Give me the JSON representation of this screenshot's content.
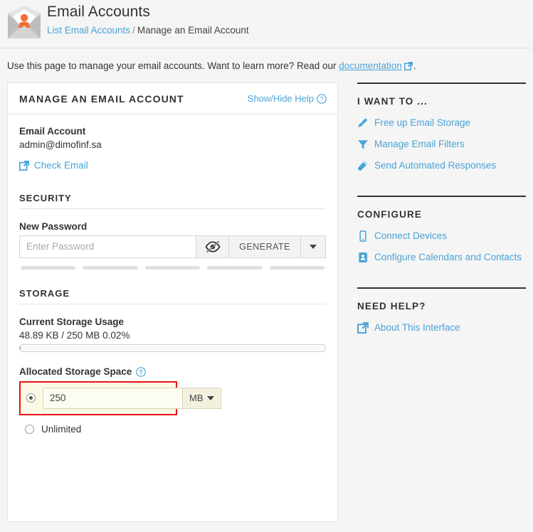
{
  "header": {
    "title": "Email Accounts",
    "icon": "email-account-envelope-icon",
    "breadcrumb": {
      "parent": "List Email Accounts",
      "separator": "/",
      "current": "Manage an Email Account"
    }
  },
  "intro": {
    "text_before": "Use this page to manage your email accounts. Want to learn more? Read our",
    "link": "documentation",
    "link_icon": "external-link-icon",
    "text_after": "."
  },
  "card": {
    "title": "MANAGE AN EMAIL ACCOUNT",
    "help_toggle": "Show/Hide Help",
    "help_icon": "question-circle-icon",
    "email_account": {
      "label": "Email Account",
      "value": "admin@dimofinf.sa",
      "check_email_link": "Check Email",
      "check_email_icon": "external-link-icon"
    },
    "security": {
      "heading": "SECURITY",
      "password_label": "New Password",
      "password_value": "",
      "password_placeholder": "Enter Password",
      "toggle_visibility_icon": "eye-slash-icon",
      "generate_label": "GENERATE",
      "generate_caret_icon": "caret-down-icon",
      "strength_segments": 5,
      "strength_filled": 0
    },
    "storage": {
      "heading": "STORAGE",
      "current_label": "Current Storage Usage",
      "current_value": "48.89 KB / 250 MB 0.02%",
      "usage_percent": 0.02,
      "allocated_label": "Allocated Storage Space",
      "allocated_help_icon": "question-circle-icon",
      "quota_selected": true,
      "quota_value": "250",
      "quota_unit": "MB",
      "quota_unit_caret_icon": "caret-down-icon",
      "unlimited_label": "Unlimited",
      "unlimited_selected": false,
      "highlight_color": "#e8161a",
      "highlight_bg": "#fbf8e3"
    }
  },
  "sidebar": {
    "sections": [
      {
        "title": "I WANT TO ...",
        "links": [
          {
            "label": "Free up Email Storage",
            "icon": "broom-icon"
          },
          {
            "label": "Manage Email Filters",
            "icon": "filter-funnel-icon"
          },
          {
            "label": "Send Automated Responses",
            "icon": "magic-wand-icon"
          }
        ]
      },
      {
        "title": "CONFIGURE",
        "links": [
          {
            "label": "Connect Devices",
            "icon": "mobile-device-icon"
          },
          {
            "label": "Configure Calendars and Contacts",
            "icon": "address-book-icon"
          }
        ]
      },
      {
        "title": "NEED HELP?",
        "links": [
          {
            "label": "About This Interface",
            "icon": "external-link-icon"
          }
        ]
      }
    ]
  },
  "colors": {
    "link": "#49a3d8",
    "accent_orange": "#f26c35",
    "page_bg": "#f5f5f5",
    "card_bg": "#ffffff"
  }
}
